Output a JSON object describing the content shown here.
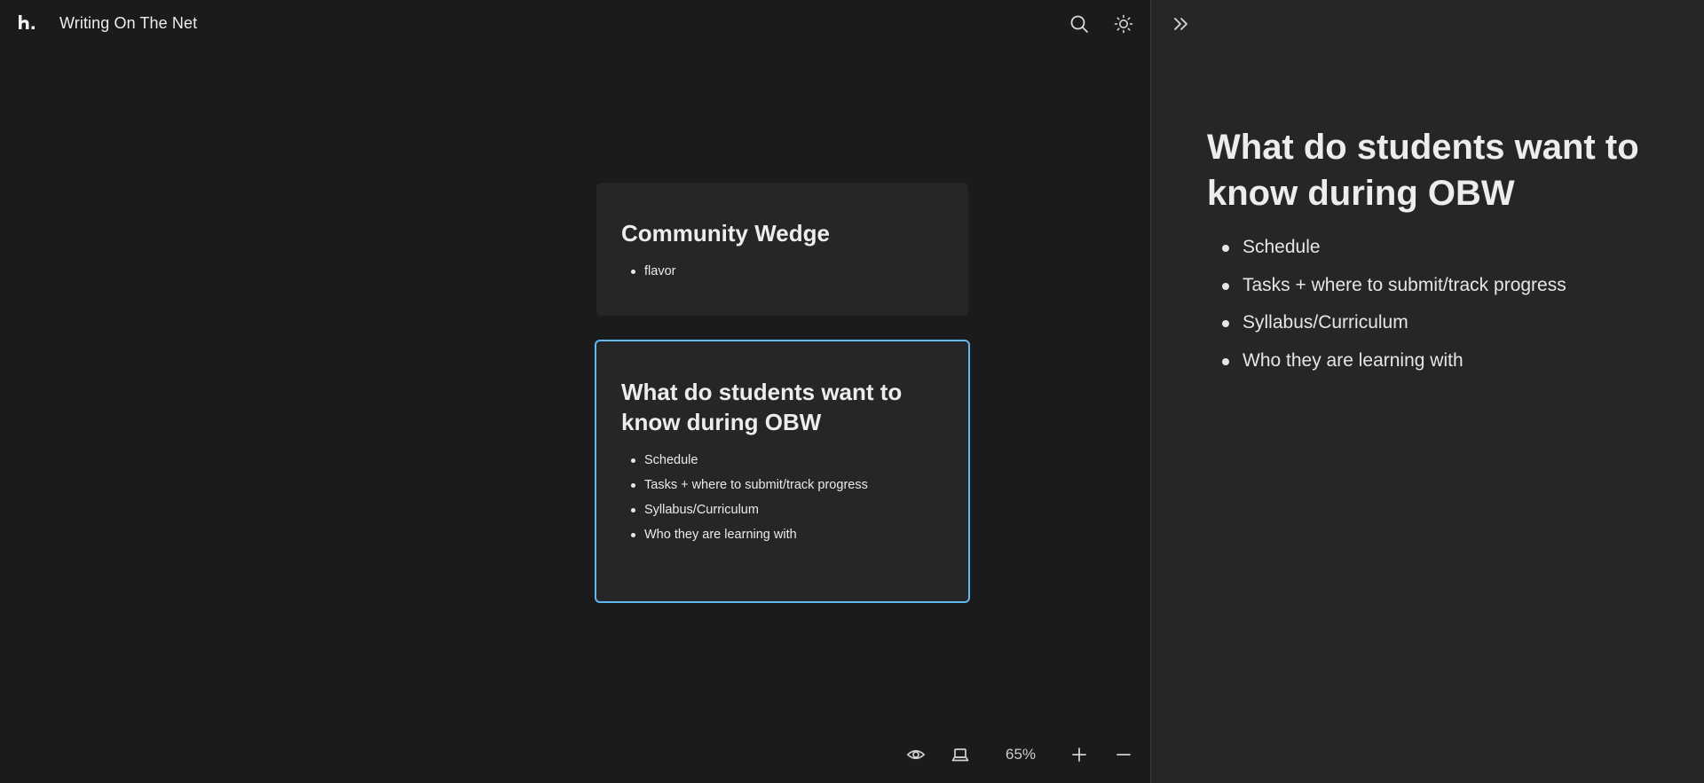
{
  "app": {
    "title": "Writing On The Net"
  },
  "topbar": {
    "icons": [
      "logo-icon",
      "search-icon",
      "sun-icon"
    ]
  },
  "cards": [
    {
      "title": "Community Wedge",
      "items": [
        "flavor"
      ],
      "selected": false
    },
    {
      "title": "What do students want to know during OBW",
      "items": [
        "Schedule",
        "Tasks + where to submit/track progress",
        "Syllabus/Curriculum",
        "Who they are learning with"
      ],
      "selected": true
    }
  ],
  "controls": {
    "zoom": "65%",
    "icons": [
      "eye-icon",
      "laptop-icon",
      "plus-icon",
      "minus-icon"
    ]
  },
  "panel": {
    "title": "What do students want to know during OBW",
    "items": [
      "Schedule",
      "Tasks + where to submit/track progress",
      "Syllabus/Curriculum",
      "Who they are learning with"
    ],
    "collapse_icon": "chevrons-right-icon"
  },
  "colors": {
    "background": "#1b1b1c",
    "card": "#262629",
    "panel": "#262629",
    "accent": "#5fb8ef",
    "text": "#ededed"
  }
}
